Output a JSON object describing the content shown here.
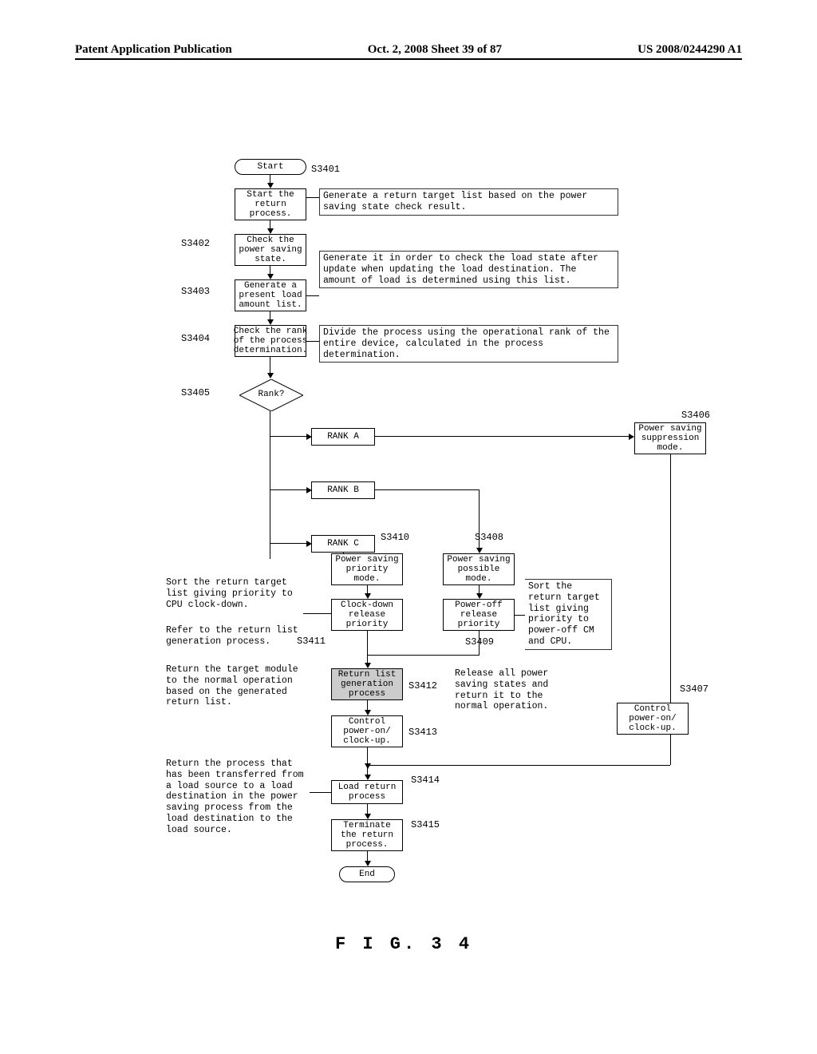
{
  "header": {
    "left": "Patent Application Publication",
    "center": "Oct. 2, 2008  Sheet 39 of 87",
    "right": "US 2008/0244290 A1"
  },
  "nodes": {
    "start": "Start",
    "s3401": "Start the return process.",
    "s3402": "Check the power saving state.",
    "s3403": "Generate a present load amount list.",
    "s3404": "Check the rank of the process determination.",
    "rank_q": "Rank?",
    "rank_a": "RANK A",
    "rank_b": "RANK B",
    "rank_c": "RANK C",
    "s3406": "Power saving suppression mode.",
    "s3407": "Control power-on/ clock-up.",
    "s3408": "Power saving possible mode.",
    "s3409": "Power-off release priority",
    "s3410": "Power saving priority mode.",
    "s3411": "Clock-down release priority",
    "s3412": "Return list generation process",
    "s3413": "Control power-on/ clock-up.",
    "s3414": "Load return process",
    "s3415": "Terminate the return process.",
    "end": "End"
  },
  "labels": {
    "s3401": "S3401",
    "s3402": "S3402",
    "s3403": "S3403",
    "s3404": "S3404",
    "s3405": "S3405",
    "s3406": "S3406",
    "s3407": "S3407",
    "s3408": "S3408",
    "s3409": "S3409",
    "s3410": "S3410",
    "s3411": "S3411",
    "s3412": "S3412",
    "s3413": "S3413",
    "s3414": "S3414",
    "s3415": "S3415"
  },
  "notes": {
    "n1": "Generate a return target list based on the power saving state check result.",
    "n2": "Generate it in order to check the load state after update when updating the load destination. The amount of load is determined using this list.",
    "n3": "Divide the process using the operational rank of the entire device, calculated in the process determination.",
    "n_sort_cd": "Sort the return target list giving priority to CPU clock-down.",
    "n_refer": "Refer to the return list generation process.",
    "n_return_mod": "Return the target module to the normal operation based on the generated return list.",
    "n_sort_po": "Sort the return target list giving priority to power-off CM and CPU.",
    "n_release": "Release all power saving states and return it to the normal operation.",
    "n_load_return": "Return the process that has been transferred from a load source to a load destination in the power saving process from the load destination to the load source."
  },
  "fig": "F I G.  3 4"
}
